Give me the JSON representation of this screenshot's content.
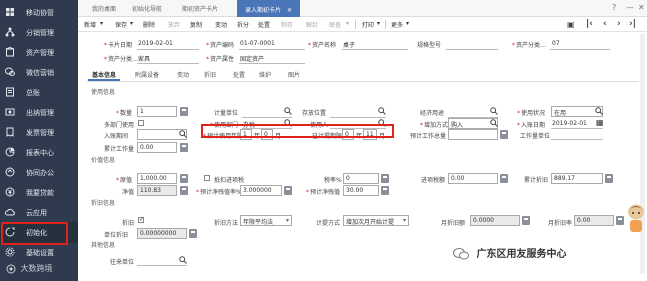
{
  "sidebar": {
    "items": [
      {
        "label": "移动协管",
        "icon": "grid-icon"
      },
      {
        "label": "分销管理",
        "icon": "network-icon"
      },
      {
        "label": "资产管理",
        "icon": "building-icon"
      },
      {
        "label": "微信营销",
        "icon": "wechat-icon"
      },
      {
        "label": "总账",
        "icon": "ledger-icon"
      },
      {
        "label": "出纳管理",
        "icon": "cashier-icon"
      },
      {
        "label": "发票管理",
        "icon": "invoice-icon"
      },
      {
        "label": "报表中心",
        "icon": "report-icon"
      },
      {
        "label": "协同办公",
        "icon": "collab-icon"
      },
      {
        "label": "我要贷款",
        "icon": "loan-icon"
      },
      {
        "label": "云应用",
        "icon": "cloud-icon"
      },
      {
        "label": "初始化",
        "icon": "init-icon"
      },
      {
        "label": "基础设置",
        "icon": "settings-icon"
      }
    ],
    "watermark": "大数跨境"
  },
  "tabs": [
    {
      "label": "我的桌面"
    },
    {
      "label": "初始化导航"
    },
    {
      "label": "期初资产卡片"
    },
    {
      "label": "录入期初卡片",
      "active": true
    }
  ],
  "toolbar": {
    "new": "新增",
    "save": "保存",
    "delete": "删除",
    "abandon": "放弃",
    "copy": "复制",
    "change": "变动",
    "split": "拆分",
    "dispose": "处置",
    "print_setting": "制存",
    "unlock": "解封",
    "link": "联查",
    "print": "打印",
    "more": "更多"
  },
  "header": {
    "date_label": "卡片日期",
    "date": "2019-02-01",
    "code_label": "资产编码",
    "code": "01-07-0001",
    "name_label": "资产名称",
    "name": "桌子",
    "spec_label": "规格型号",
    "category_label": "资产分类",
    "category": "07",
    "category2_label": "资产分类",
    "category2": "家具",
    "attr_label": "资产属性",
    "attr": "固定资产"
  },
  "subtabs": [
    "基本信息",
    "附属设备",
    "变动",
    "折旧",
    "处置",
    "维护",
    "图片"
  ],
  "sections": {
    "use": "使用信息",
    "value": "价值信息",
    "depreciation": "折旧信息",
    "other": "其他信息"
  },
  "use_info": {
    "qty_label": "数量",
    "qty": "1",
    "unit_label": "计量单位",
    "location_label": "存放位置",
    "economic_label": "经济用途",
    "status_label": "使用状况",
    "status": "在用",
    "multi_dept_label": "多部门使用",
    "dept_label": "使用部门",
    "dept": "办税",
    "user_label": "使用人",
    "add_method_label": "增加方式",
    "add_method": "购入",
    "entry_date_label": "入账日期",
    "entry_date": "2019-02-01",
    "entry_period_label": "入账期间",
    "life_label": "预计使用年限",
    "life_year": "1",
    "life_year_unit": "年",
    "life_month": "0",
    "life_month_unit": "月",
    "used_label": "已计提期限",
    "used_year": "0",
    "used_year_unit": "年",
    "used_month": "11",
    "used_month_unit": "月",
    "workload_label": "预计工作总量",
    "workload_unit_label": "工作量单位",
    "acc_workload_label": "累计工作量",
    "acc_workload": "0.00"
  },
  "value_info": {
    "orig_label": "原值",
    "orig": "1,000.00",
    "deductible_label": "抵扣进项税",
    "tax_rate_label": "税率%",
    "tax_rate": "0",
    "input_tax_label": "进项税额",
    "input_tax": "0.00",
    "acc_dep_label": "累计折旧",
    "acc_dep": "889.17",
    "net_label": "净值",
    "net": "110.83",
    "residual_rate_label": "预计净残值率%",
    "residual_rate": "3.000000",
    "residual_label": "预计净残值",
    "residual": "30.00"
  },
  "dep_info": {
    "dep_label": "折旧",
    "method_label": "折旧方法",
    "method": "年限平均法",
    "calc_label": "计提方式",
    "calc": "增加次月开始计提",
    "month_amt_label": "月折旧额",
    "month_amt": "0.0000",
    "month_rate_label": "月折旧率",
    "month_rate": "0.00",
    "unit_dep_label": "单位折旧",
    "unit_dep": "0.00000000"
  },
  "other_info": {
    "vendor_label": "往来单位"
  },
  "wechat_watermark": "广东区用友服务中心",
  "colors": {
    "sidebar": "#2f3a4e",
    "accent": "#4a76b9",
    "highlight": "#e0231c"
  }
}
